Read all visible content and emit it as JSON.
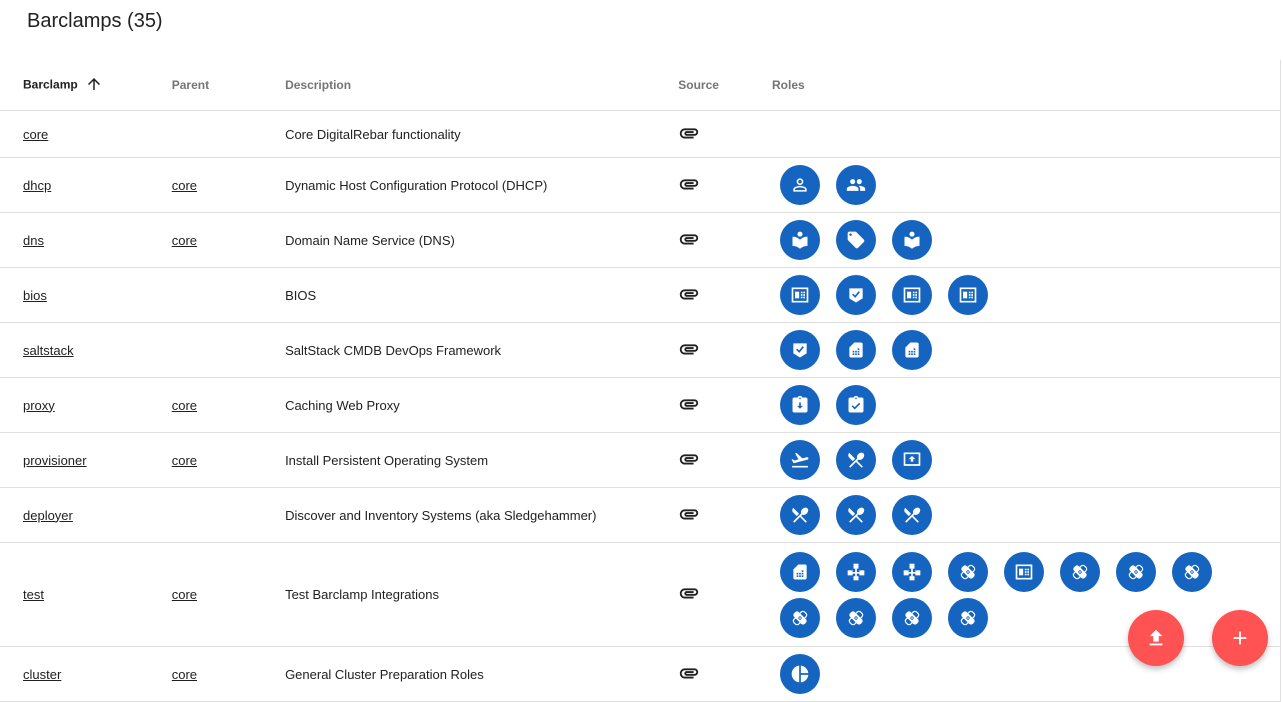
{
  "title": "Barclamps (35)",
  "columns": {
    "barclamp": "Barclamp",
    "parent": "Parent",
    "description": "Description",
    "source": "Source",
    "roles": "Roles"
  },
  "colors": {
    "role_bg": "#1565c0",
    "fab_bg": "#ff5252"
  },
  "rows": [
    {
      "name": "core",
      "parent": "",
      "description": "Core DigitalRebar functionality",
      "roles": []
    },
    {
      "name": "dhcp",
      "parent": "core",
      "description": "Dynamic Host Configuration Protocol (DHCP)",
      "roles": [
        "person-icon",
        "group-icon"
      ]
    },
    {
      "name": "dns",
      "parent": "core",
      "description": "Domain Name Service (DNS)",
      "roles": [
        "book-icon",
        "tag-icon",
        "book-icon"
      ]
    },
    {
      "name": "bios",
      "parent": "",
      "description": "BIOS",
      "roles": [
        "chip-icon",
        "shield-check-icon",
        "chip-icon",
        "chip-icon"
      ]
    },
    {
      "name": "saltstack",
      "parent": "",
      "description": "SaltStack CMDB DevOps Framework",
      "roles": [
        "shield-check-icon",
        "sim-card-icon",
        "sim-card-icon"
      ]
    },
    {
      "name": "proxy",
      "parent": "core",
      "description": "Caching Web Proxy",
      "roles": [
        "clipboard-download-icon",
        "clipboard-check-icon"
      ]
    },
    {
      "name": "provisioner",
      "parent": "core",
      "description": "Install Persistent Operating System",
      "roles": [
        "flight-takeoff-icon",
        "utensils-icon",
        "upload-screen-icon"
      ]
    },
    {
      "name": "deployer",
      "parent": "",
      "description": "Discover and Inventory Systems (aka Sledgehammer)",
      "roles": [
        "utensils-icon",
        "utensils-icon",
        "utensils-icon"
      ]
    },
    {
      "name": "test",
      "parent": "core",
      "description": "Test Barclamp Integrations",
      "roles": [
        "sim-card-icon",
        "network-icon",
        "network-icon",
        "bandage-icon",
        "chip-icon",
        "bandage-icon",
        "bandage-icon",
        "bandage-icon",
        "bandage-icon",
        "bandage-icon",
        "bandage-icon",
        "bandage-icon"
      ]
    },
    {
      "name": "cluster",
      "parent": "core",
      "description": "General Cluster Preparation Roles",
      "roles": [
        "pie-chart-icon"
      ]
    }
  ]
}
